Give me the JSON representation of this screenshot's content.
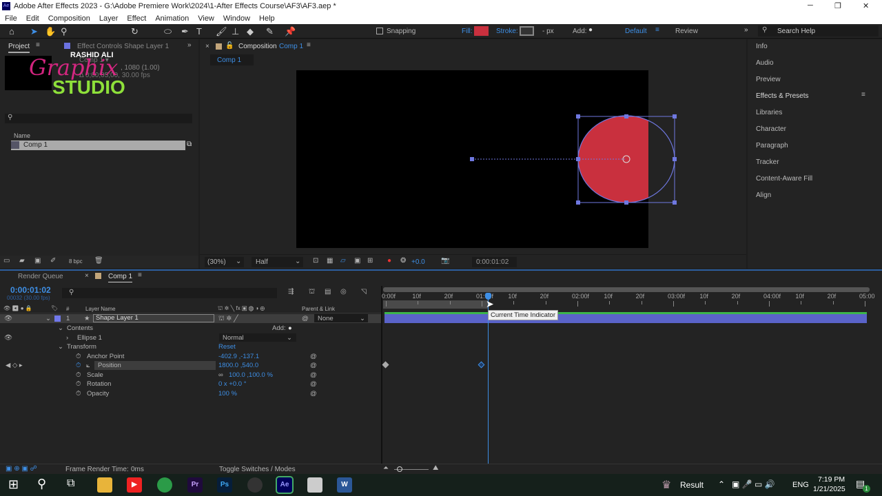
{
  "window": {
    "title": "Adobe After Effects 2023 - G:\\Adobe Premiere Work\\2024\\1-After Effects Course\\AF3\\AF3.aep *",
    "minimize": "─",
    "maximize": "❐",
    "close": "✕"
  },
  "menu": [
    "File",
    "Edit",
    "Composition",
    "Layer",
    "Effect",
    "Animation",
    "View",
    "Window",
    "Help"
  ],
  "toolbar": {
    "snapping": "Snapping",
    "fill_label": "Fill:",
    "stroke_label": "Stroke:",
    "px_label": "- px",
    "add_label": "Add:",
    "workspace_default": "Default",
    "workspace_review": "Review",
    "search_placeholder": "Search Help",
    "fill_color": "#c9303e"
  },
  "project": {
    "tab": "Project",
    "effect_tab": "Effect Controls Shape Layer 1",
    "name_header": "Name",
    "items": [
      "Comp 1"
    ],
    "bit_depth": "8 bpc",
    "info_line1": "Comp 1 ▾",
    "info_line2": ", 1080 (1.00)",
    "info_line3": "Δ 0;00;05;00, 30.00 fps"
  },
  "watermark": {
    "line1": "RASHID ALI",
    "line2": "Graphix",
    "line3": "STUDIO"
  },
  "composition": {
    "tab_label": "Composition",
    "comp_name": "Comp 1",
    "breadcrumb": "Comp 1",
    "zoom": "(30%)",
    "resolution": "Half",
    "exposure": "+0.0",
    "timecode": "0:00:01:02"
  },
  "right_panel": [
    "Info",
    "Audio",
    "Preview",
    "Effects & Presets",
    "Libraries",
    "Character",
    "Paragraph",
    "Tracker",
    "Content-Aware Fill",
    "Align"
  ],
  "timeline": {
    "render_queue": "Render Queue",
    "comp_tab": "Comp 1",
    "timecode": "0:00:01:02",
    "frame_info": "00032 (30.00 fps)",
    "col_layer_name": "Layer Name",
    "col_parent": "Parent & Link",
    "col_num": "#",
    "layer": {
      "num": "1",
      "name": "Shape Layer 1",
      "parent": "None"
    },
    "contents": "Contents",
    "add": "Add:",
    "ellipse": "Ellipse 1",
    "blend": "Normal",
    "transform": "Transform",
    "reset": "Reset",
    "props": [
      {
        "name": "Anchor Point",
        "value": "-402.9 ,-137.1"
      },
      {
        "name": "Position",
        "value": "1800.0 ,540.0"
      },
      {
        "name": "Scale",
        "value": "100.0 ,100.0 %"
      },
      {
        "name": "Rotation",
        "value": "0 x +0.0 °"
      },
      {
        "name": "Opacity",
        "value": "100 %"
      }
    ],
    "ruler": [
      "0:00f",
      "10f",
      "20f",
      "01:00f",
      "10f",
      "20f",
      "02:00f",
      "10f",
      "20f",
      "03:00f",
      "10f",
      "20f",
      "04:00f",
      "10f",
      "20f",
      "05:00"
    ],
    "current_frame": 32,
    "total_frames": 150,
    "keyframes": [
      0,
      30
    ],
    "tooltip": "Current Time Indicator",
    "frame_render_label": "Frame Render Time:",
    "frame_render_value": "0ms",
    "toggle": "Toggle Switches / Modes"
  },
  "taskbar": {
    "apps": [
      "Pr",
      "Ps",
      "Ae",
      "W"
    ],
    "weather": "Result",
    "lang": "ENG",
    "time": "7:19 PM",
    "date": "1/21/2025",
    "notif": "1"
  }
}
